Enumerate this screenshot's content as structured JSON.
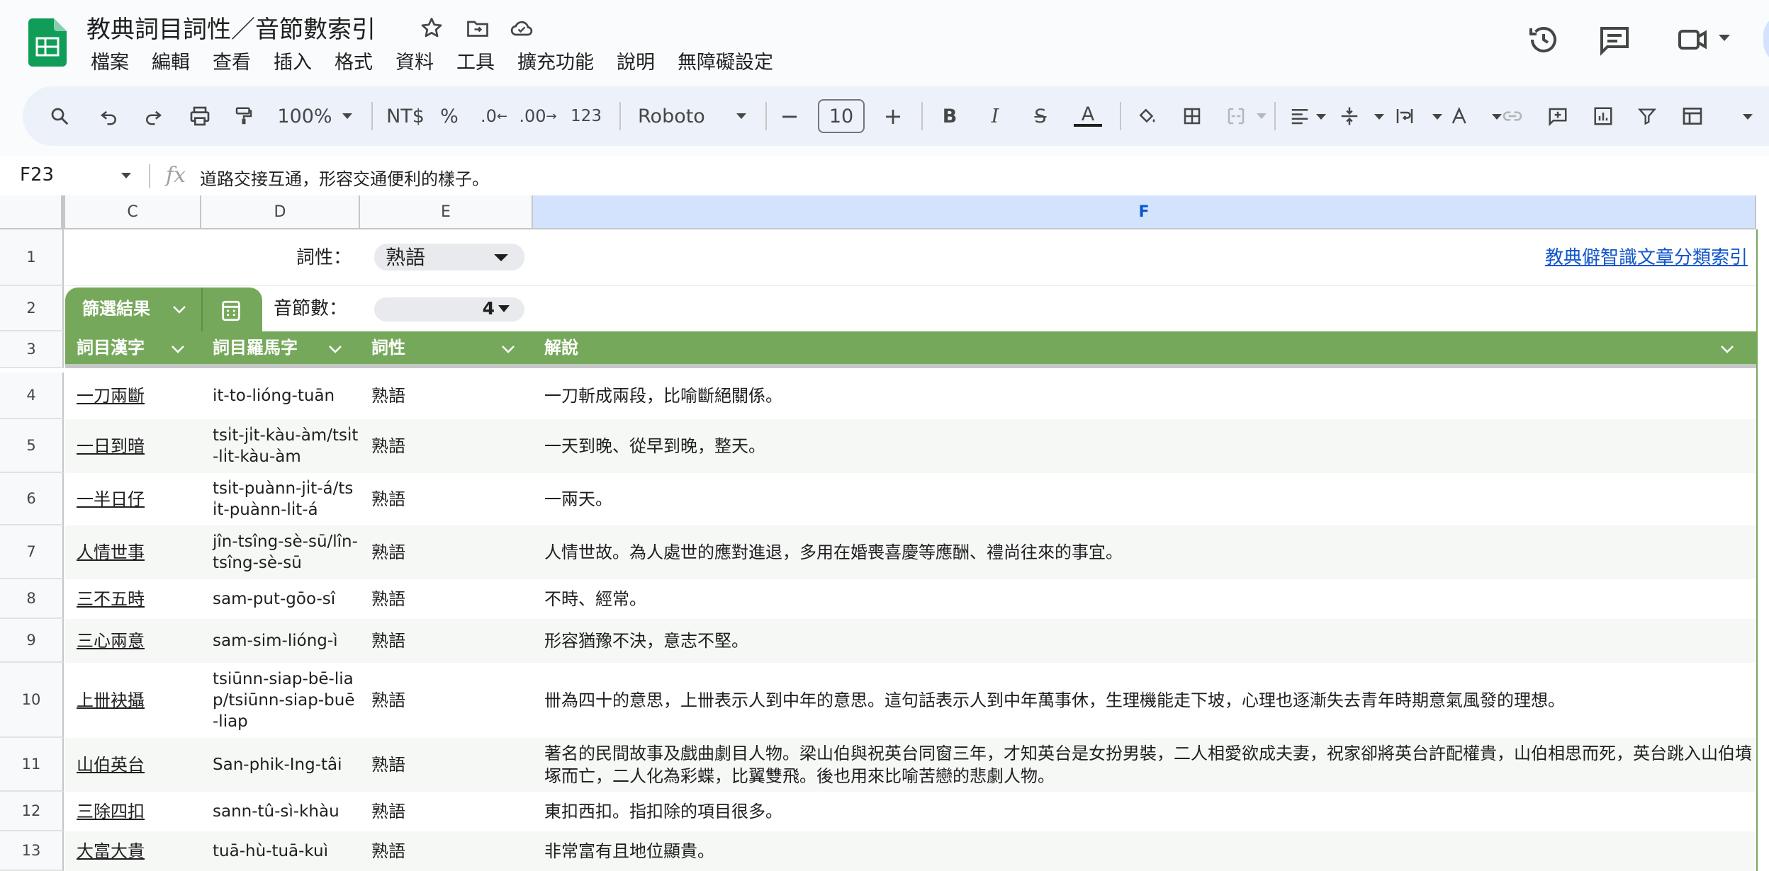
{
  "app": {
    "title": "教典詞目詞性／音節數索引"
  },
  "menu": [
    "檔案",
    "編輯",
    "查看",
    "插入",
    "格式",
    "資料",
    "工具",
    "擴充功能",
    "說明",
    "無障礙設定"
  ],
  "toolbar": {
    "zoom": "100%",
    "currency": "NT$",
    "percent": "%",
    "dec_decrease": ".0",
    "dec_increase": ".00",
    "number_format": "123",
    "font": "Roboto",
    "font_size": "10",
    "minus": "−",
    "plus": "+",
    "bold": "B",
    "italic": "I",
    "strike": "S",
    "text_color": "A"
  },
  "formula_bar": {
    "cell_ref": "F23",
    "fx": "fx",
    "content": "道路交接互通，形容交通便利的樣子。"
  },
  "columns": [
    "C",
    "D",
    "E",
    "F"
  ],
  "sheet": {
    "row1": {
      "label": "詞性：",
      "selected": "熟語",
      "link": "教典僻智識文章分類索引"
    },
    "row2": {
      "filter_label": "篩選結果",
      "label": "音節數：",
      "selected": "4"
    },
    "headers": [
      "詞目漢字",
      "詞目羅馬字",
      "詞性",
      "解說"
    ],
    "rows": [
      {
        "num": "4",
        "hanzi": "一刀兩斷",
        "roman": "it-to-lióng-tuān",
        "pos": "熟語",
        "desc": "一刀斬成兩段，比喻斷絕關係。"
      },
      {
        "num": "5",
        "hanzi": "一日到暗",
        "roman": "tsi̍t-ji̍t-kàu-àm/tsi̍t-li̍t-kàu-àm",
        "pos": "熟語",
        "desc": "一天到晚、從早到晚，整天。"
      },
      {
        "num": "6",
        "hanzi": "一半日仔",
        "roman": "tsi̍t-puànn-ji̍t-á/tsi̍t-puànn-li̍t-á",
        "pos": "熟語",
        "desc": "一兩天。"
      },
      {
        "num": "7",
        "hanzi": "人情世事",
        "roman": "jîn-tsîng-sè-sū/lîn-tsîng-sè-sū",
        "pos": "熟語",
        "desc": "人情世故。為人處世的應對進退，多用在婚喪喜慶等應酬、禮尚往來的事宜。"
      },
      {
        "num": "8",
        "hanzi": "三不五時",
        "roman": "sam-put-gōo-sî",
        "pos": "熟語",
        "desc": "不時、經常。"
      },
      {
        "num": "9",
        "hanzi": "三心兩意",
        "roman": "sam-sim-lióng-ì",
        "pos": "熟語",
        "desc": "形容猶豫不決，意志不堅。"
      },
      {
        "num": "10",
        "hanzi": "上卌袂攝",
        "roman": "tsiūnn-siap-bē-liap/tsiūnn-siap-buē-liap",
        "pos": "熟語",
        "desc": "卌為四十的意思，上卌表示人到中年的意思。這句話表示人到中年萬事休，生理機能走下坡，心理也逐漸失去青年時期意氣風發的理想。"
      },
      {
        "num": "11",
        "hanzi": "山伯英台",
        "roman": "San-phik-Ing-tâi",
        "pos": "熟語",
        "desc": "著名的民間故事及戲曲劇目人物。梁山伯與祝英台同窗三年，才知英台是女扮男裝，二人相愛欲成夫妻，祝家卻將英台許配權貴，山伯相思而死，英台跳入山伯墳塚而亡，二人化為彩蝶，比翼雙飛。後也用來比喻苦戀的悲劇人物。"
      },
      {
        "num": "12",
        "hanzi": "三除四扣",
        "roman": "sann-tû-sì-khàu",
        "pos": "熟語",
        "desc": "東扣西扣。指扣除的項目很多。"
      },
      {
        "num": "13",
        "hanzi": "大富大貴",
        "roman": "tuā-hù-tuā-kuì",
        "pos": "熟語",
        "desc": "非常富有且地位顯貴。"
      }
    ]
  },
  "colors": {
    "header_green": "#76a85b",
    "sheets_green": "#0f9d58",
    "selected_col": "#d3e3fd"
  }
}
